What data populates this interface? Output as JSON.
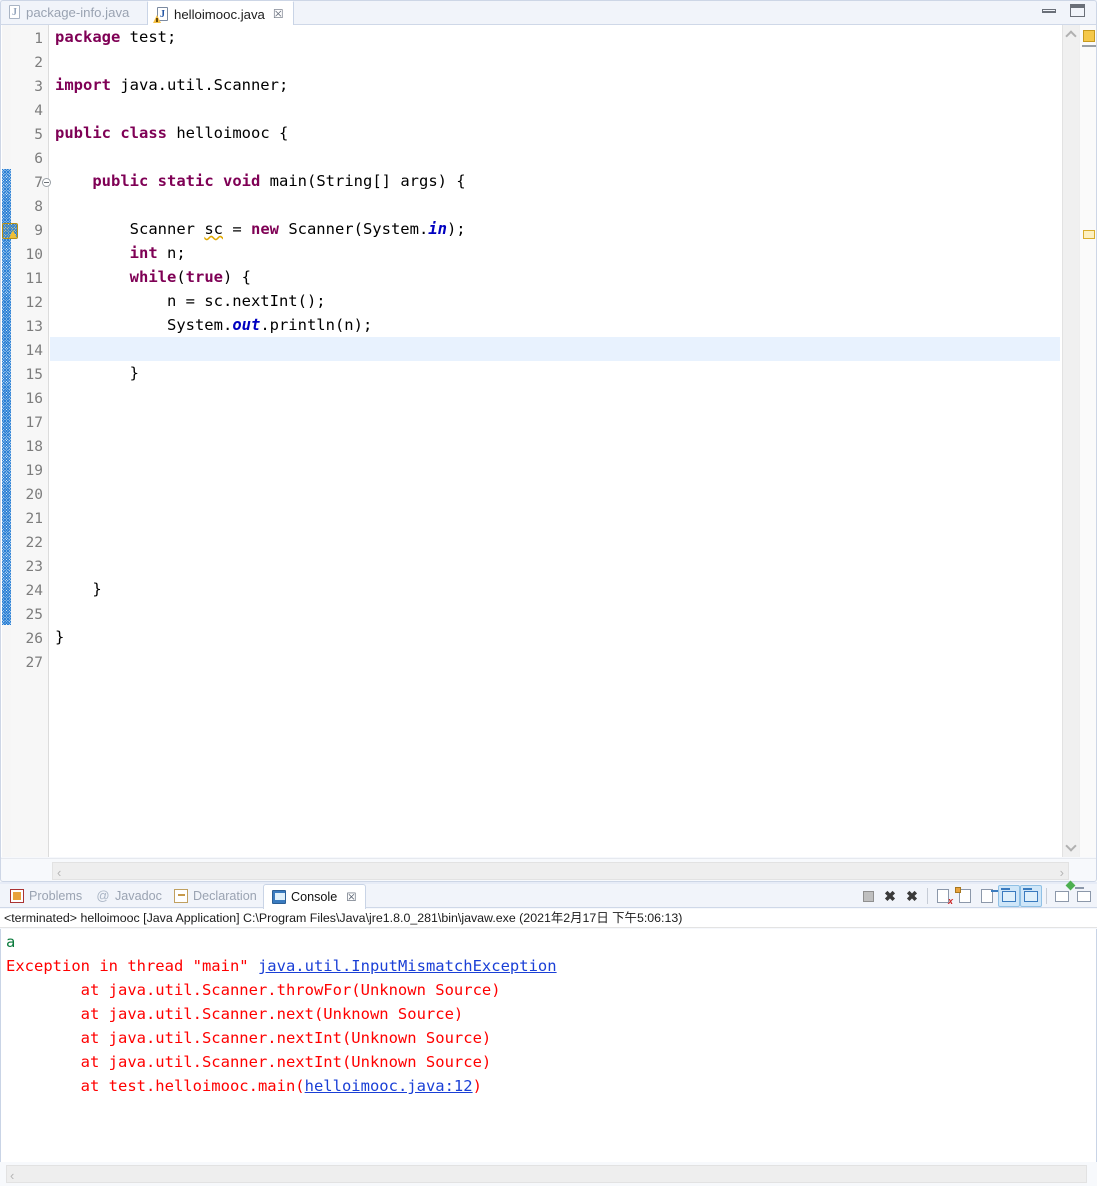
{
  "window": {
    "minimize_label": "minimize",
    "maximize_label": "maximize"
  },
  "editor": {
    "tabs": [
      {
        "label": "package-info.java",
        "active": false,
        "icon": "java-file-icon"
      },
      {
        "label": "helloimooc.java",
        "active": true,
        "icon": "java-file-warning-icon",
        "close": "☒"
      }
    ],
    "line_numbers": [
      "1",
      "2",
      "3",
      "4",
      "5",
      "6",
      "7",
      "8",
      "9",
      "10",
      "11",
      "12",
      "13",
      "14",
      "15",
      "16",
      "17",
      "18",
      "19",
      "20",
      "21",
      "22",
      "23",
      "24",
      "25",
      "26",
      "27"
    ],
    "current_line": 14,
    "warning_line": 9,
    "fold_line": 7,
    "lines": [
      {
        "n": 1,
        "tokens": [
          {
            "t": "package",
            "c": "kw"
          },
          {
            "t": " test;",
            "c": ""
          }
        ]
      },
      {
        "n": 2,
        "tokens": []
      },
      {
        "n": 3,
        "tokens": [
          {
            "t": "import",
            "c": "kw"
          },
          {
            "t": " java.util.Scanner;",
            "c": ""
          }
        ]
      },
      {
        "n": 4,
        "tokens": []
      },
      {
        "n": 5,
        "tokens": [
          {
            "t": "public",
            "c": "kw"
          },
          {
            "t": " ",
            "c": ""
          },
          {
            "t": "class",
            "c": "kw"
          },
          {
            "t": " helloimooc {",
            "c": ""
          }
        ]
      },
      {
        "n": 6,
        "tokens": []
      },
      {
        "n": 7,
        "tokens": [
          {
            "t": "    ",
            "c": ""
          },
          {
            "t": "public",
            "c": "kw"
          },
          {
            "t": " ",
            "c": ""
          },
          {
            "t": "static",
            "c": "kw"
          },
          {
            "t": " ",
            "c": ""
          },
          {
            "t": "void",
            "c": "kw"
          },
          {
            "t": " main(String[] args) {",
            "c": ""
          }
        ]
      },
      {
        "n": 8,
        "tokens": []
      },
      {
        "n": 9,
        "tokens": [
          {
            "t": "        Scanner ",
            "c": ""
          },
          {
            "t": "sc",
            "c": "warnword"
          },
          {
            "t": " = ",
            "c": ""
          },
          {
            "t": "new",
            "c": "kw"
          },
          {
            "t": " Scanner(System.",
            "c": ""
          },
          {
            "t": "in",
            "c": "sfield"
          },
          {
            "t": ");",
            "c": ""
          }
        ]
      },
      {
        "n": 10,
        "tokens": [
          {
            "t": "        ",
            "c": ""
          },
          {
            "t": "int",
            "c": "kw"
          },
          {
            "t": " n;",
            "c": ""
          }
        ]
      },
      {
        "n": 11,
        "tokens": [
          {
            "t": "        ",
            "c": ""
          },
          {
            "t": "while",
            "c": "kw"
          },
          {
            "t": "(",
            "c": ""
          },
          {
            "t": "true",
            "c": "kw"
          },
          {
            "t": ") {",
            "c": ""
          }
        ]
      },
      {
        "n": 12,
        "tokens": [
          {
            "t": "            n = sc.nextInt();",
            "c": ""
          }
        ]
      },
      {
        "n": 13,
        "tokens": [
          {
            "t": "            System.",
            "c": ""
          },
          {
            "t": "out",
            "c": "sfield"
          },
          {
            "t": ".println(n);",
            "c": ""
          }
        ]
      },
      {
        "n": 14,
        "tokens": []
      },
      {
        "n": 15,
        "tokens": [
          {
            "t": "        }",
            "c": ""
          }
        ]
      },
      {
        "n": 16,
        "tokens": []
      },
      {
        "n": 17,
        "tokens": []
      },
      {
        "n": 18,
        "tokens": []
      },
      {
        "n": 19,
        "tokens": []
      },
      {
        "n": 20,
        "tokens": []
      },
      {
        "n": 21,
        "tokens": []
      },
      {
        "n": 22,
        "tokens": []
      },
      {
        "n": 23,
        "tokens": []
      },
      {
        "n": 24,
        "tokens": [
          {
            "t": "    }",
            "c": ""
          }
        ]
      },
      {
        "n": 25,
        "tokens": []
      },
      {
        "n": 26,
        "tokens": [
          {
            "t": "}",
            "c": ""
          }
        ]
      },
      {
        "n": 27,
        "tokens": []
      }
    ]
  },
  "console_panel": {
    "tabs": [
      {
        "label": "Problems",
        "active": false,
        "icon": "problems-icon"
      },
      {
        "label": "Javadoc",
        "active": false,
        "icon": "javadoc-at-icon"
      },
      {
        "label": "Declaration",
        "active": false,
        "icon": "declaration-icon"
      },
      {
        "label": "Console",
        "active": true,
        "icon": "console-icon",
        "close": "☒"
      }
    ],
    "toolbar": [
      {
        "name": "terminate-button",
        "glyph": "stop-square-icon",
        "toggled": false
      },
      {
        "name": "remove-launch-button",
        "glyph": "x-icon",
        "toggled": false
      },
      {
        "name": "remove-all-terminated-button",
        "glyph": "double-x-icon",
        "toggled": false
      },
      {
        "name": "clear-console-button",
        "glyph": "clear-icon",
        "toggled": false
      },
      {
        "name": "scroll-lock-button",
        "glyph": "lock-icon",
        "toggled": false
      },
      {
        "name": "word-wrap-button",
        "glyph": "wrap-icon",
        "toggled": false
      },
      {
        "name": "show-console-on-output-button",
        "glyph": "monitor-icon",
        "toggled": true
      },
      {
        "name": "show-console-on-error-button",
        "glyph": "monitor-error-icon",
        "toggled": true
      },
      {
        "name": "pin-console-button",
        "glyph": "pin-icon",
        "toggled": false
      },
      {
        "name": "display-selected-console-button",
        "glyph": "console-select-icon",
        "toggled": false
      }
    ],
    "launch_info": "<terminated> helloimooc [Java Application] C:\\Program Files\\Java\\jre1.8.0_281\\bin\\javaw.exe (2021年2月17日 下午5:06:13)",
    "output": [
      {
        "segments": [
          {
            "t": "a",
            "c": "o-green"
          }
        ]
      },
      {
        "segments": [
          {
            "t": "Exception in thread \"main\" ",
            "c": "o-red"
          },
          {
            "t": "java.util.InputMismatchException",
            "c": "o-link"
          }
        ]
      },
      {
        "segments": [
          {
            "t": "        at java.util.Scanner.throwFor(Unknown Source)",
            "c": "o-red"
          }
        ]
      },
      {
        "segments": [
          {
            "t": "        at java.util.Scanner.next(Unknown Source)",
            "c": "o-red"
          }
        ]
      },
      {
        "segments": [
          {
            "t": "        at java.util.Scanner.nextInt(Unknown Source)",
            "c": "o-red"
          }
        ]
      },
      {
        "segments": [
          {
            "t": "        at java.util.Scanner.nextInt(Unknown Source)",
            "c": "o-red"
          }
        ]
      },
      {
        "segments": [
          {
            "t": "        at test.helloimooc.main(",
            "c": "o-red"
          },
          {
            "t": "helloimooc.java:12",
            "c": "o-link"
          },
          {
            "t": ")",
            "c": "o-red"
          }
        ]
      }
    ]
  },
  "scroll": {
    "left_arrow": "‹",
    "right_arrow": "›"
  },
  "colors": {
    "keyword": "#7f0055",
    "static_field": "#0000c0",
    "error_text": "#ff0000",
    "link": "#1a3fd6",
    "stdout_echo": "#0a7a3c",
    "current_line_highlight": "#e8f2fe",
    "change_bar": "#2a7fd4",
    "warning_marker": "#f5c84a"
  }
}
